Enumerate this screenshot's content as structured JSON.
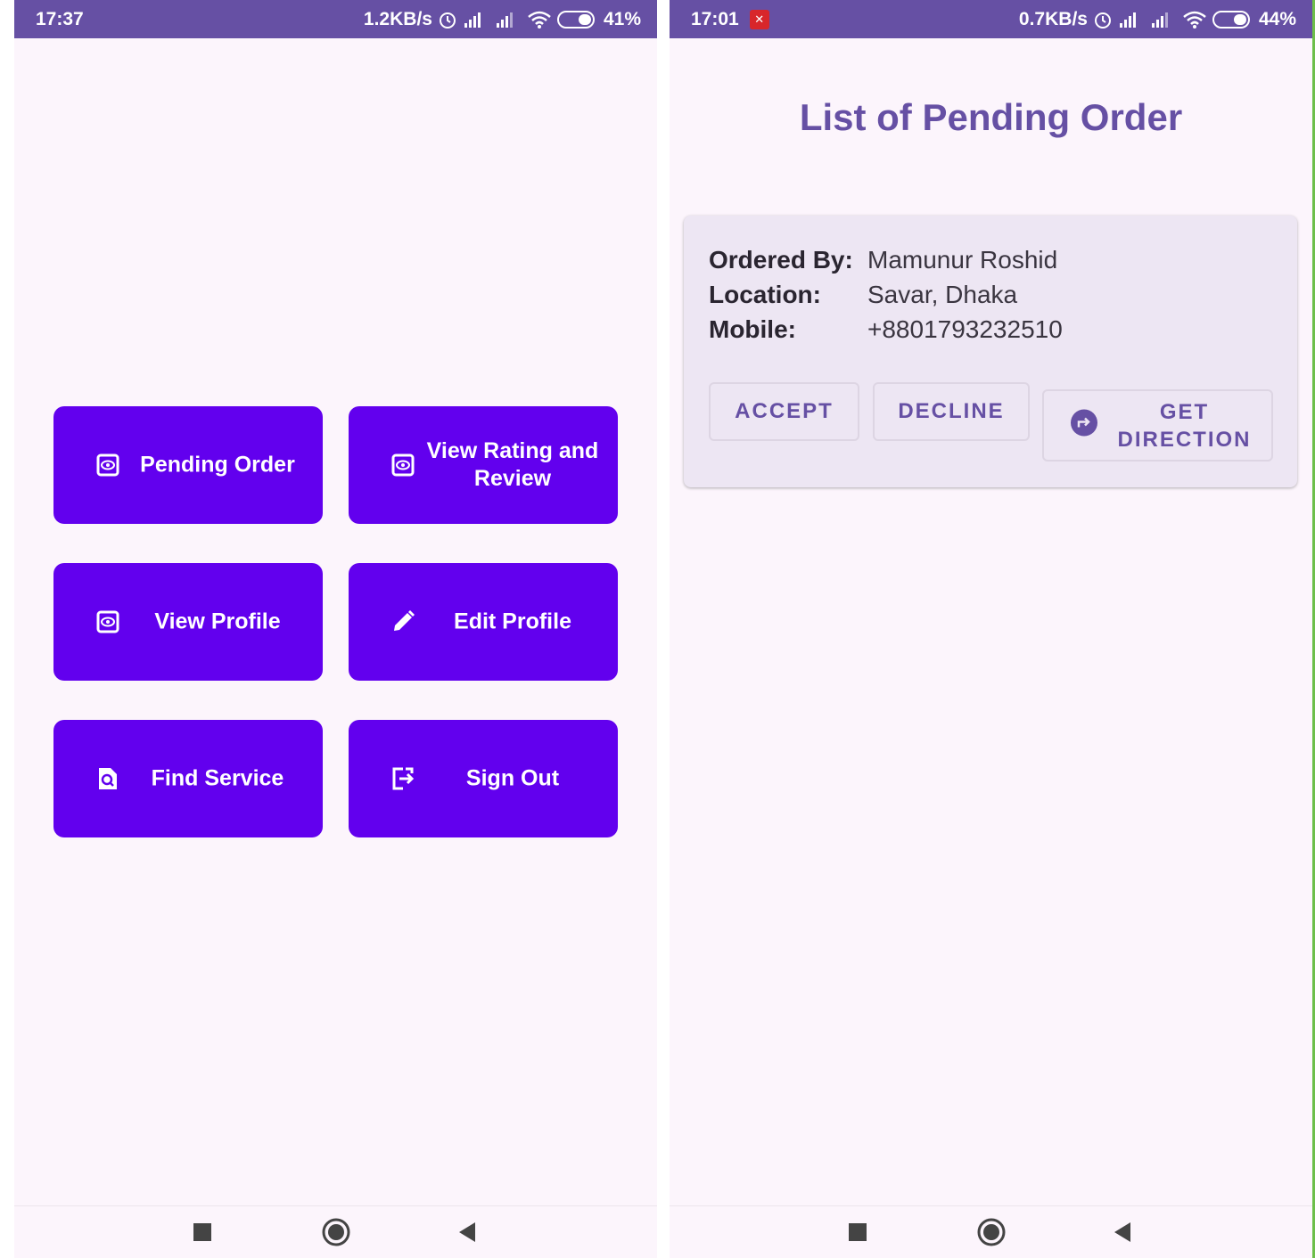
{
  "left_screen": {
    "status": {
      "time": "17:37",
      "speed": "1.2KB/s",
      "battery": "41%"
    },
    "buttons": [
      {
        "label": "Pending Order",
        "icon": "eye-box-icon"
      },
      {
        "label": "View Rating and Review",
        "icon": "eye-box-icon"
      },
      {
        "label": "View Profile",
        "icon": "eye-box-icon"
      },
      {
        "label": "Edit Profile",
        "icon": "pencil-icon"
      },
      {
        "label": "Find Service",
        "icon": "file-search-icon"
      },
      {
        "label": "Sign Out",
        "icon": "exit-icon"
      }
    ]
  },
  "right_screen": {
    "status": {
      "time": "17:01",
      "speed": "0.7KB/s",
      "battery": "44%"
    },
    "title": "List of Pending Order",
    "order": {
      "ordered_by_label": "Ordered By:",
      "ordered_by": "Mamunur Roshid",
      "location_label": "Location:",
      "location": "Savar, Dhaka",
      "mobile_label": "Mobile:",
      "mobile": "+8801793232510"
    },
    "actions": {
      "accept": "ACCEPT",
      "decline": "DECLINE",
      "direction_line1": "GET",
      "direction_line2": "DIRECTION"
    }
  },
  "colors": {
    "status_bar": "#6650a4",
    "button": "#6200ee",
    "background": "#fcf5fc",
    "card": "#ede6f3",
    "title": "#6650a4"
  }
}
